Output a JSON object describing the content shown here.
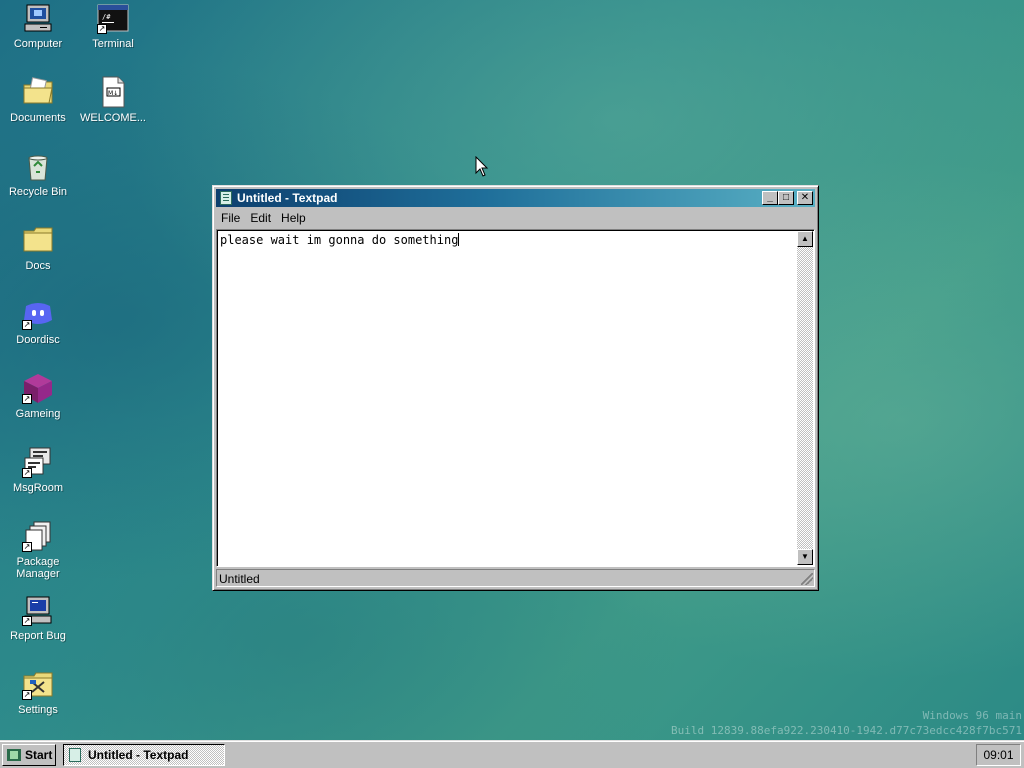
{
  "desktop": {
    "icons": [
      {
        "label": "Computer",
        "icon": "computer-icon"
      },
      {
        "label": "Terminal",
        "icon": "terminal-icon"
      },
      {
        "label": "Documents",
        "icon": "documents-folder-icon"
      },
      {
        "label": "WELCOME...",
        "icon": "markdown-file-icon"
      },
      {
        "label": "Recycle Bin",
        "icon": "recycle-bin-icon"
      },
      {
        "label": "Docs",
        "icon": "folder-icon"
      },
      {
        "label": "Doordisc",
        "icon": "doordisc-icon"
      },
      {
        "label": "Gameing",
        "icon": "game-cube-icon"
      },
      {
        "label": "MsgRoom",
        "icon": "msgroom-icon"
      },
      {
        "label": "Package Manager",
        "icon": "package-manager-icon"
      },
      {
        "label": "Report Bug",
        "icon": "report-bug-icon"
      },
      {
        "label": "Settings",
        "icon": "settings-icon"
      }
    ],
    "watermark": {
      "line1": "Windows 96 main",
      "line2": "Build 12839.88efa922.230410-1942.d77c73edcc428f7bc571"
    }
  },
  "window": {
    "title": "Untitled - Textpad",
    "menu": [
      "File",
      "Edit",
      "Help"
    ],
    "content": "please wait im gonna do something",
    "status": "Untitled",
    "controls": {
      "minimize": "_",
      "maximize": "□",
      "close": "✕"
    }
  },
  "taskbar": {
    "start_label": "Start",
    "tasks": [
      {
        "label": "Untitled - Textpad"
      }
    ],
    "clock": "09:01"
  }
}
